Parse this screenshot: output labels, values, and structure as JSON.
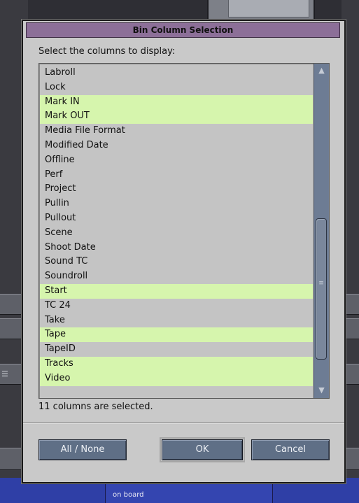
{
  "dialog": {
    "title": "Bin Column Selection",
    "prompt": "Select the columns to display:",
    "status": "11 columns are selected.",
    "items": [
      {
        "label": "Labroll",
        "selected": false
      },
      {
        "label": "Lock",
        "selected": false
      },
      {
        "label": "Mark IN",
        "selected": true
      },
      {
        "label": "Mark OUT",
        "selected": true
      },
      {
        "label": "Media File Format",
        "selected": false
      },
      {
        "label": "Modified Date",
        "selected": false
      },
      {
        "label": "Offline",
        "selected": false
      },
      {
        "label": "Perf",
        "selected": false
      },
      {
        "label": "Project",
        "selected": false
      },
      {
        "label": "Pullin",
        "selected": false
      },
      {
        "label": "Pullout",
        "selected": false
      },
      {
        "label": "Scene",
        "selected": false
      },
      {
        "label": "Shoot Date",
        "selected": false
      },
      {
        "label": "Sound TC",
        "selected": false
      },
      {
        "label": "Soundroll",
        "selected": false
      },
      {
        "label": "Start",
        "selected": true
      },
      {
        "label": "TC 24",
        "selected": false
      },
      {
        "label": "Take",
        "selected": false
      },
      {
        "label": "Tape",
        "selected": true
      },
      {
        "label": "TapeID",
        "selected": false
      },
      {
        "label": "Tracks",
        "selected": true
      },
      {
        "label": "Video",
        "selected": true
      }
    ],
    "buttons": {
      "all_none": "All / None",
      "ok": "OK",
      "cancel": "Cancel"
    },
    "scroll_position": 0.85
  },
  "background": {
    "footer_text": "on board"
  },
  "colors": {
    "selected_row": "#d6f5ad",
    "titlebar": "#8c6f98",
    "button": "#5f6f86",
    "scrollbar": "#6d7c94"
  }
}
